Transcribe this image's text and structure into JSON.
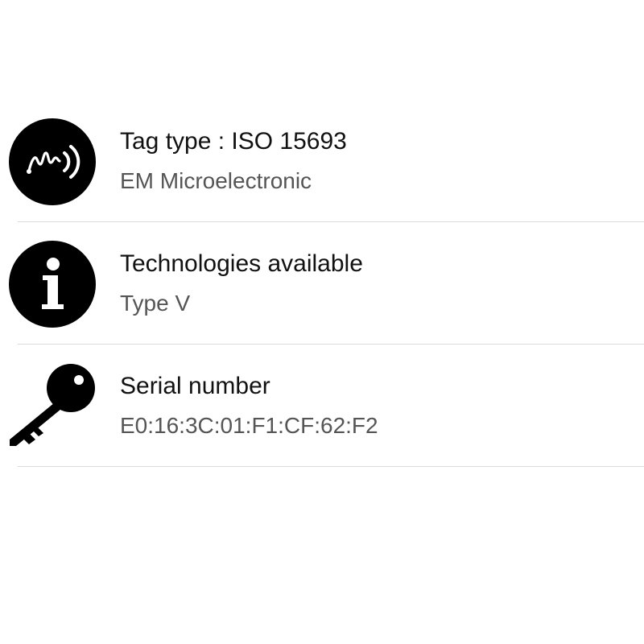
{
  "rows": [
    {
      "icon": "nfc-tag-icon",
      "title": "Tag type : ISO 15693",
      "subtitle": "EM Microelectronic"
    },
    {
      "icon": "info-icon",
      "title": "Technologies available",
      "subtitle": "Type V"
    },
    {
      "icon": "key-icon",
      "title": "Serial number",
      "subtitle": "E0:16:3C:01:F1:CF:62:F2"
    }
  ],
  "colors": {
    "icon": "#000000",
    "title": "#111111",
    "subtitle": "#555555",
    "divider": "#d9d9d9",
    "background": "#ffffff"
  }
}
